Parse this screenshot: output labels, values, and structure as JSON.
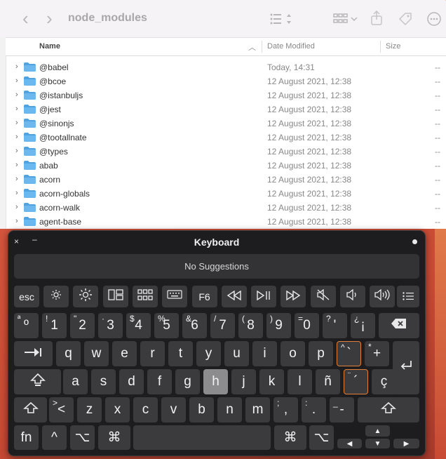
{
  "finder": {
    "title": "node_modules",
    "nav": {
      "back": "‹",
      "forward": "›"
    },
    "columns": {
      "name": "Name",
      "date": "Date Modified",
      "size": "Size",
      "sort_indicator": "︿"
    },
    "rows": [
      {
        "name": "@babel",
        "date": "Today, 14:31",
        "size": "--"
      },
      {
        "name": "@bcoe",
        "date": "12 August 2021, 12:38",
        "size": "--"
      },
      {
        "name": "@istanbuljs",
        "date": "12 August 2021, 12:38",
        "size": "--"
      },
      {
        "name": "@jest",
        "date": "12 August 2021, 12:38",
        "size": "--"
      },
      {
        "name": "@sinonjs",
        "date": "12 August 2021, 12:38",
        "size": "--"
      },
      {
        "name": "@tootallnate",
        "date": "12 August 2021, 12:38",
        "size": "--"
      },
      {
        "name": "@types",
        "date": "12 August 2021, 12:38",
        "size": "--"
      },
      {
        "name": "abab",
        "date": "12 August 2021, 12:38",
        "size": "--"
      },
      {
        "name": "acorn",
        "date": "12 August 2021, 12:38",
        "size": "--"
      },
      {
        "name": "acorn-globals",
        "date": "12 August 2021, 12:38",
        "size": "--"
      },
      {
        "name": "acorn-walk",
        "date": "12 August 2021, 12:38",
        "size": "--"
      },
      {
        "name": "agent-base",
        "date": "12 August 2021, 12:38",
        "size": "--"
      }
    ]
  },
  "keyboard": {
    "title": "Keyboard",
    "close": "×",
    "minimize": "–",
    "suggestions": "No Suggestions",
    "fn_row": {
      "esc": "esc",
      "f6": "F6"
    },
    "number_row": [
      {
        "top": "ª",
        "main": "º"
      },
      {
        "top": "!",
        "main": "1"
      },
      {
        "top": "\"",
        "main": "2"
      },
      {
        "top": "·",
        "main": "3"
      },
      {
        "top": "$",
        "main": "4"
      },
      {
        "top": "%",
        "main": "5"
      },
      {
        "top": "&",
        "main": "6"
      },
      {
        "top": "/",
        "main": "7"
      },
      {
        "top": "(",
        "main": "8"
      },
      {
        "top": ")",
        "main": "9"
      },
      {
        "top": "=",
        "main": "0"
      },
      {
        "top": "?",
        "main": "'"
      },
      {
        "top": "¿",
        "main": "¡"
      }
    ],
    "row_q": [
      "q",
      "w",
      "e",
      "r",
      "t",
      "y",
      "u",
      "i",
      "o",
      "p"
    ],
    "row_q_extra": [
      {
        "top": "^",
        "main": "`"
      },
      {
        "top": "*",
        "main": "+"
      }
    ],
    "row_a": [
      "a",
      "s",
      "d",
      "f",
      "g",
      "h",
      "j",
      "k",
      "l",
      "ñ"
    ],
    "row_a_extra": [
      {
        "top": "¨",
        "main": "´"
      },
      {
        "top": "",
        "main": "ç"
      }
    ],
    "row_z": [
      "z",
      "x",
      "c",
      "v",
      "b",
      "n",
      "m"
    ],
    "row_z_extra": [
      {
        "top": ">",
        "main": "<"
      },
      {
        "top": ";",
        "main": ","
      },
      {
        "top": ":",
        "main": "."
      },
      {
        "top": "_",
        "main": "-"
      }
    ],
    "bottom": {
      "fn": "fn",
      "ctrl": "^",
      "opt": "⌥",
      "cmd": "⌘"
    },
    "highlighted_key": "h",
    "arrows": {
      "up": "▲",
      "left": "◀",
      "down": "▼",
      "right": "▶"
    }
  },
  "colors": {
    "accent_folder": "#5aaee8",
    "key_bg": "#3b3a3d",
    "highlight": "#8c8c8f",
    "dead_key_border": "#e0803a"
  }
}
